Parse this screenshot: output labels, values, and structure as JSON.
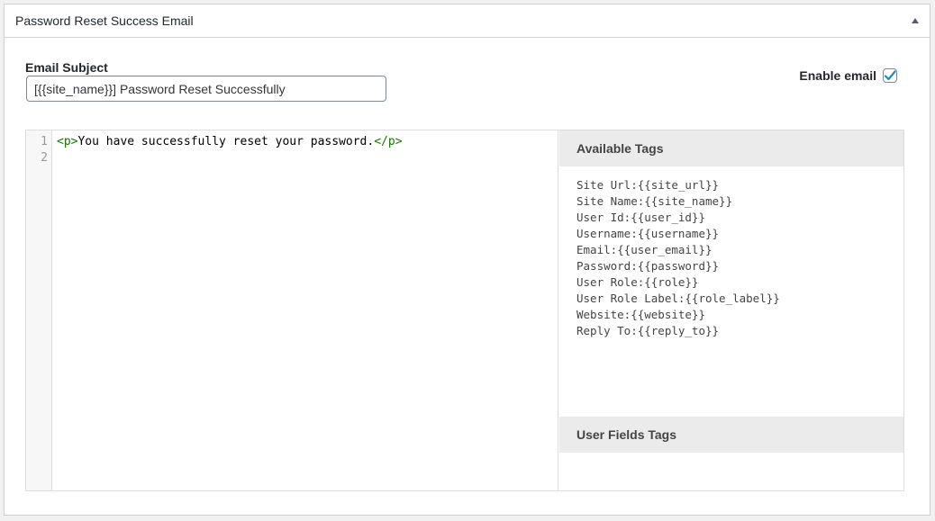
{
  "box": {
    "title": "Password Reset Success Email"
  },
  "subject": {
    "label": "Email Subject",
    "value": "[{{site_name}}] Password Reset Successfully"
  },
  "enable": {
    "label": "Enable email",
    "checked": true,
    "accent_color": "#1e8cbe"
  },
  "editor": {
    "line_numbers": [
      "1",
      "2"
    ],
    "line1_open_tag": "<p>",
    "line1_text": "You have successfully reset your password.",
    "line1_close_tag": "</p>",
    "line2_text": ""
  },
  "available_tags": {
    "heading": "Available Tags",
    "items": [
      "Site Url:{{site_url}}",
      "Site Name:{{site_name}}",
      "User Id:{{user_id}}",
      "Username:{{username}}",
      "Email:{{user_email}}",
      "Password:{{password}}",
      "User Role:{{role}}",
      "User Role Label:{{role_label}}",
      "Website:{{website}}",
      "Reply To:{{reply_to}}"
    ]
  },
  "user_fields_tags": {
    "heading": "User Fields Tags"
  }
}
